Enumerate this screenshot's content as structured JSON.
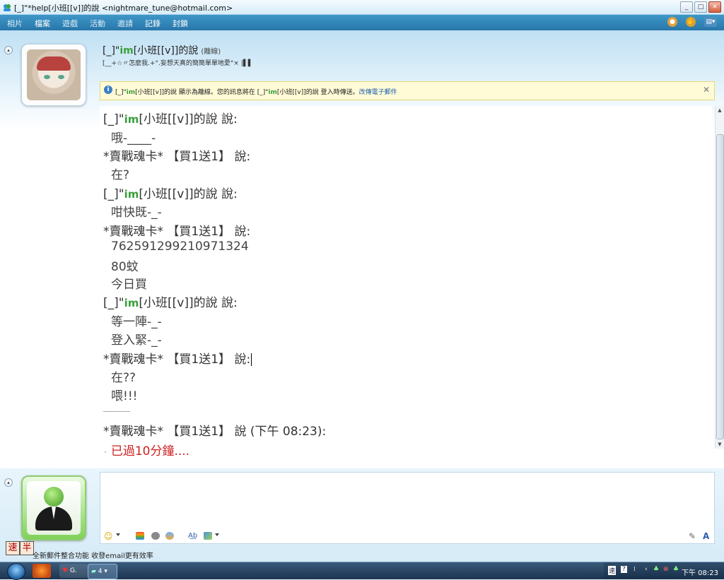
{
  "window": {
    "title": "[_]\"*help[小班[[v]]的說 <nightmare_tune@hotmail.com>"
  },
  "menu": {
    "items": [
      "相片",
      "檔案",
      "遊戲",
      "活動",
      "邀請",
      "記錄",
      "封鎖"
    ]
  },
  "contact": {
    "name_prefix": "[_]\"",
    "name_im": "im",
    "name_suffix": "[小班[[v]]的說",
    "status": "(離線)",
    "personal_message": "[__+☆〃怎麼我.+°.妄想天真的簡簡單單地愛°× |▌▌"
  },
  "infobar": {
    "text_prefix": "[_]\"",
    "text_im": "im",
    "text_mid": "[小班[[v]]的說 顯示為離線。您的訊息將在 [_]\"",
    "text_im2": "im",
    "text_end": "[小班[[v]]的說 登入時傳送。",
    "link": "改傳電子郵件"
  },
  "conversation": {
    "contact_prefix": "[_]\"",
    "contact_im": "im",
    "contact_suffix": "[小班[[v]]的說 說:",
    "me_header": "*賣戰魂卡* 【買1送1】 說:",
    "msg1": "哦-____-",
    "msg2": "在?",
    "msg3": "咁快既-_-",
    "msg4": "762591299210971324",
    "msg5": "80蚊",
    "msg6": "今日買",
    "msg7": "等一陣-_-",
    "msg8": "登入緊-_-",
    "msg9": "在??",
    "msg10": "喂!!!",
    "last_header": "*賣戰魂卡* 【買1送1】 說 (下午 08:23):",
    "alert_dot": "·",
    "alert": "已過10分鐘...."
  },
  "ime": {
    "mode1": "速",
    "mode2": "半"
  },
  "ad": {
    "text": "全新郵件整合功能  收發email更有效率"
  },
  "taskbar": {
    "task1_label": "G.",
    "task2_label": "4",
    "clock": "下午 08:23"
  },
  "colors": {
    "menubar": "#2f86bc",
    "alert_text": "#cc2222",
    "infobar_bg": "#fffbd6",
    "im_green": "#3aa03a"
  },
  "icons": [
    "app-icon",
    "minimize-icon",
    "maximize-icon",
    "close-icon",
    "emoticon-icon",
    "wink-icon",
    "nudge-icon",
    "font-icon",
    "color-icon",
    "start-orb-icon"
  ]
}
